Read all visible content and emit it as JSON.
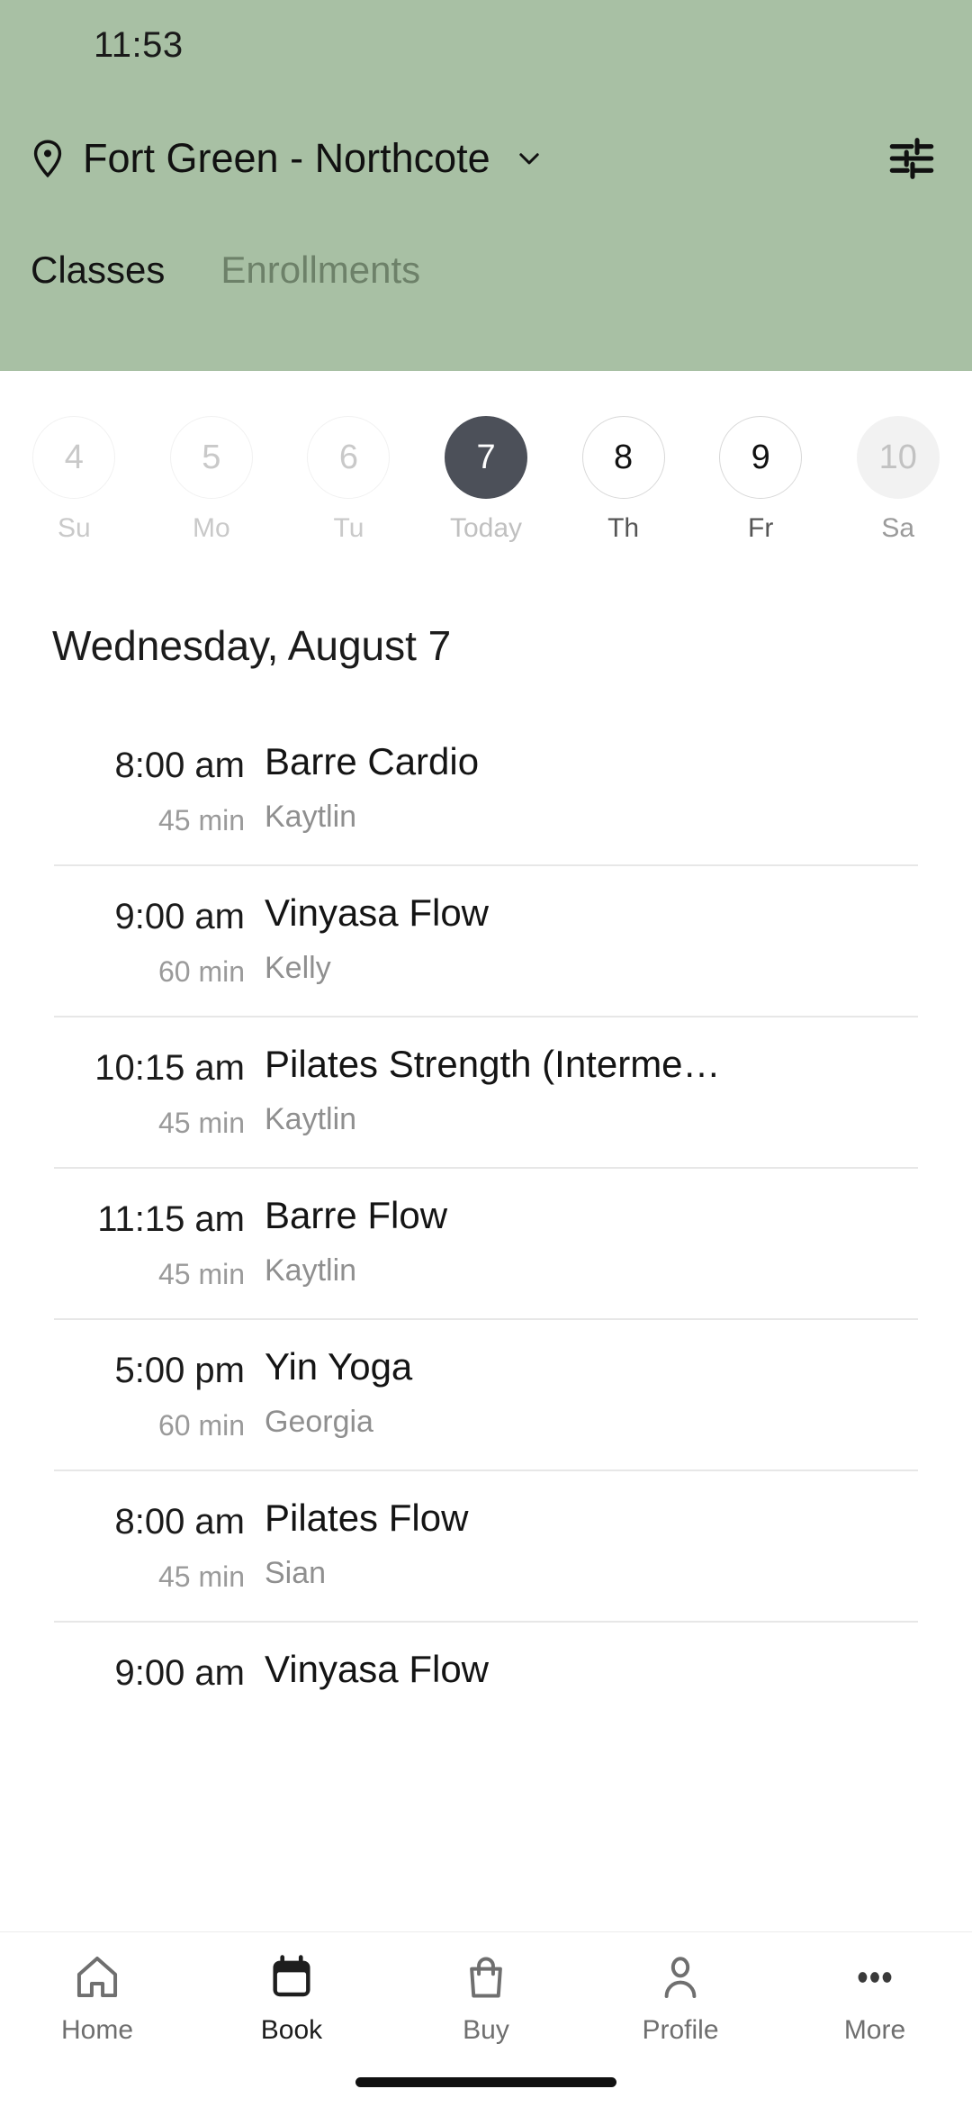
{
  "status_bar": {
    "time": "11:53"
  },
  "header": {
    "location_name": "Fort Green - Northcote",
    "pin_icon": "location-pin-icon",
    "chevron_icon": "chevron-down-icon",
    "filter_icon": "filter-sliders-icon",
    "colors": {
      "background": "#a8c0a4",
      "active_tab_text": "#141414",
      "inactive_tab_text": "#6d8169"
    },
    "tabs": [
      {
        "label": "Classes",
        "active": true
      },
      {
        "label": "Enrollments",
        "active": false
      }
    ]
  },
  "date_strip": {
    "days": [
      {
        "number": "4",
        "weekday": "Su",
        "state": "past"
      },
      {
        "number": "5",
        "weekday": "Mo",
        "state": "past"
      },
      {
        "number": "6",
        "weekday": "Tu",
        "state": "past"
      },
      {
        "number": "7",
        "weekday": "Today",
        "state": "selected"
      },
      {
        "number": "8",
        "weekday": "Th",
        "state": "future"
      },
      {
        "number": "9",
        "weekday": "Fr",
        "state": "future"
      },
      {
        "number": "10",
        "weekday": "Sa",
        "state": "muted"
      }
    ],
    "selected_color": "#4c5059"
  },
  "schedule": {
    "day_heading": "Wednesday, August 7",
    "classes": [
      {
        "time": "8:00 am",
        "duration": "45 min",
        "name": "Barre Cardio",
        "teacher": "Kaytlin"
      },
      {
        "time": "9:00 am",
        "duration": "60 min",
        "name": "Vinyasa Flow",
        "teacher": "Kelly"
      },
      {
        "time": "10:15 am",
        "duration": "45 min",
        "name": "Pilates Strength (Interme…",
        "teacher": "Kaytlin"
      },
      {
        "time": "11:15 am",
        "duration": "45 min",
        "name": "Barre Flow",
        "teacher": "Kaytlin"
      },
      {
        "time": "5:00 pm",
        "duration": "60 min",
        "name": "Yin Yoga",
        "teacher": "Georgia"
      },
      {
        "time": "8:00 am",
        "duration": "45 min",
        "name": "Pilates Flow",
        "teacher": "Sian"
      },
      {
        "time": "9:00 am",
        "duration": "",
        "name": "Vinyasa Flow",
        "teacher": ""
      }
    ]
  },
  "bottom_nav": {
    "items": [
      {
        "label": "Home",
        "icon": "home-icon",
        "active": false
      },
      {
        "label": "Book",
        "icon": "calendar-icon",
        "active": true
      },
      {
        "label": "Buy",
        "icon": "shopping-bag-icon",
        "active": false
      },
      {
        "label": "Profile",
        "icon": "person-icon",
        "active": false
      },
      {
        "label": "More",
        "icon": "ellipsis-icon",
        "active": false
      }
    ]
  }
}
